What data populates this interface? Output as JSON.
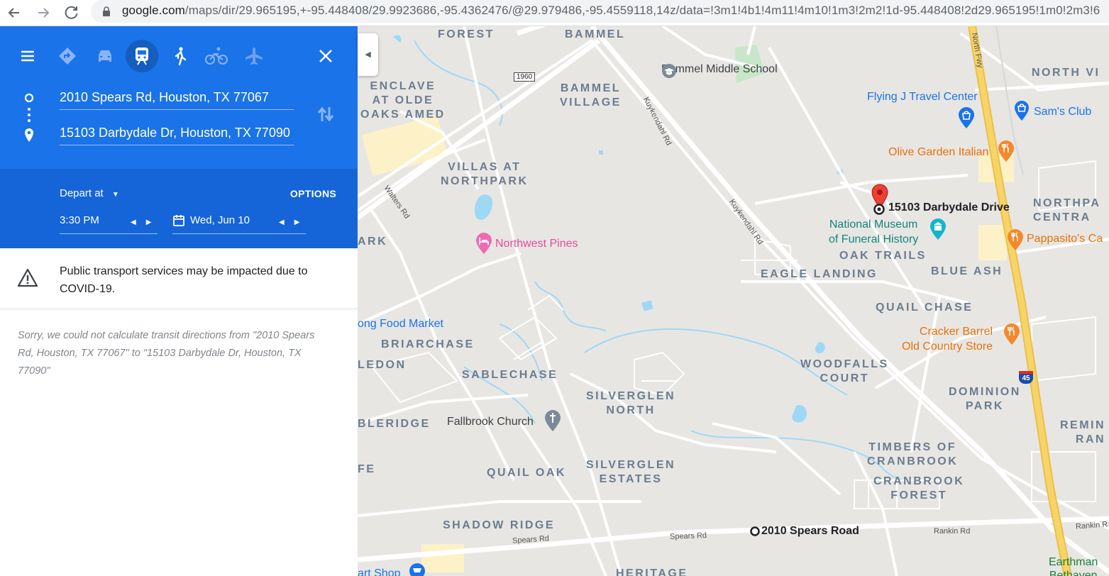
{
  "browser": {
    "url_domain": "google.com",
    "url_path": "/maps/dir/29.965195,+-95.448408/29.9923686,-95.4362476/@29.979486,-95.4559118,14z/data=!3m1!4b1!4m11!4m10!1m3!2m2!1d-95.448408!2d29.965195!1m0!2m3!6"
  },
  "directions": {
    "origin": "2010 Spears Rd, Houston, TX 77067",
    "destination": "15103 Darbydale Dr, Houston, TX 77090",
    "modes": [
      "best-route",
      "driving",
      "transit",
      "walking",
      "cycling",
      "flights"
    ],
    "active_mode": "transit"
  },
  "depart": {
    "label": "Depart at",
    "options_label": "OPTIONS",
    "time": "3:30 PM",
    "date": "Wed, Jun 10"
  },
  "notice": {
    "covid_text": "Public transport services may be impacted due to COVID-19.",
    "error_text": "Sorry, we could not calculate transit directions from \"2010 Spears Rd, Houston, TX 77067\" to \"15103 Darbydale Dr, Houston, TX 77090\""
  },
  "map": {
    "markers": {
      "destination": "15103 Darbydale Drive",
      "origin": "2010 Spears Road"
    },
    "neighborhoods": {
      "forest": "FOREST",
      "bammel": "BAMMEL",
      "enclave": "ENCLAVE\nAT OLDE\nOAKS AMED",
      "bammel_village": "BAMMEL\nVILLAGE",
      "villas": "VILLAS AT\nNORTHPARK",
      "ark": "ARK",
      "north_vi": "NORTH VI",
      "northpa": "NORTHPA\nCENTRA",
      "oak_trails": "OAK TRAILS",
      "eagle_landing": "EAGLE LANDING",
      "blue_ash": "BLUE ASH",
      "quail_chase": "QUAIL CHASE",
      "briarchase": "BRIARCHASE",
      "ledon": "LEDON",
      "sablechase": "SABLECHASE",
      "woodfalls": "WOODFALLS\nCOURT",
      "silverglen_north": "SILVERGLEN\nNORTH",
      "dominion": "DOMINION\nPARK",
      "bleridge": "BLERIDGE",
      "remin": "REMIN\nRAN",
      "timbers": "TIMBERS OF\nCRANBROOK",
      "fe": "FE",
      "quail_oak": "QUAIL OAK",
      "silverglen_estates": "SILVERGLEN\nESTATES",
      "cranbrook_forest": "CRANBROOK\nFOREST",
      "shadow_ridge": "SHADOW RIDGE",
      "heritage": "HERITAGE"
    },
    "pois": {
      "bammel_school": "Bammel Middle School",
      "flying_j": "Flying J Travel Center",
      "sams": "Sam's Club",
      "olive_garden": "Olive Garden Italian",
      "museum": "National Museum\nof Funeral History",
      "pappasitos": "Pappasito's Ca",
      "northwest_pines": "Northwest Pines",
      "food_market": "ong Food Market",
      "fallbrook": "Fallbrook Church",
      "cracker_barrel": "Cracker Barrel\nOld Country Store",
      "earthman": "Earthman\nBethaven",
      "art_shop": "art Shop"
    },
    "roads": {
      "kuykendahl1": "Kuykendahl Rd",
      "kuykendahl2": "Kuykendahl Rd",
      "walters": "Walters Rd",
      "north_fwy": "North Fwy",
      "spears1": "Spears Rd",
      "spears2": "Spears Rd",
      "rankin1": "Rankin Rd",
      "rankin2": "Rankin R",
      "fm1960": "1960",
      "i45": "45"
    }
  },
  "colors": {
    "primary_blue": "#1a73e8",
    "depart_blue": "#1565d8",
    "freeway_yellow": "#f8d468",
    "map_bg": "#e8e6e3",
    "water": "#9fd8f5",
    "marker_red": "#ea4335"
  }
}
